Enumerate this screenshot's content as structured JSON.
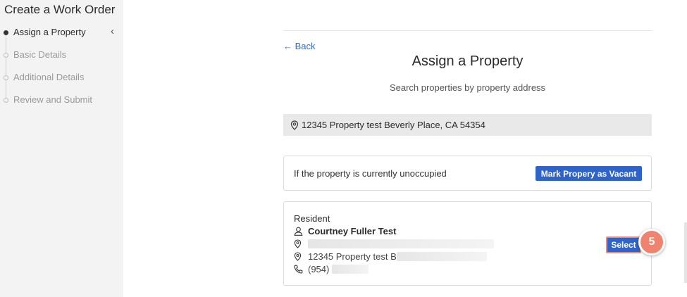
{
  "sidebar": {
    "title": "Create a Work Order",
    "steps": [
      {
        "label": "Assign a Property",
        "active": true
      },
      {
        "label": "Basic Details",
        "active": false
      },
      {
        "label": "Additional Details",
        "active": false
      },
      {
        "label": "Review and Submit",
        "active": false
      }
    ],
    "collapse_icon": "chevron-left-icon"
  },
  "main": {
    "back_label": "← Back",
    "title": "Assign a Property",
    "subtitle": "Search properties by property address",
    "search": {
      "value": "12345 Property test Beverly Place, CA 54354",
      "icon": "map-pin-icon"
    },
    "vacant": {
      "message": "If the property is currently unoccupied",
      "button_label": "Mark Propery as Vacant"
    },
    "resident": {
      "heading": "Resident",
      "name": "Courtney Fuller Test",
      "address2_prefix": "12345 Property test B",
      "phone_prefix": "(954)",
      "select_label": "Select"
    },
    "step_badge": "5"
  },
  "colors": {
    "primary_button": "#2f63c7",
    "link": "#2f6fcf",
    "badge": "#f0836f",
    "sidebar_bg": "#f3f3f3"
  }
}
